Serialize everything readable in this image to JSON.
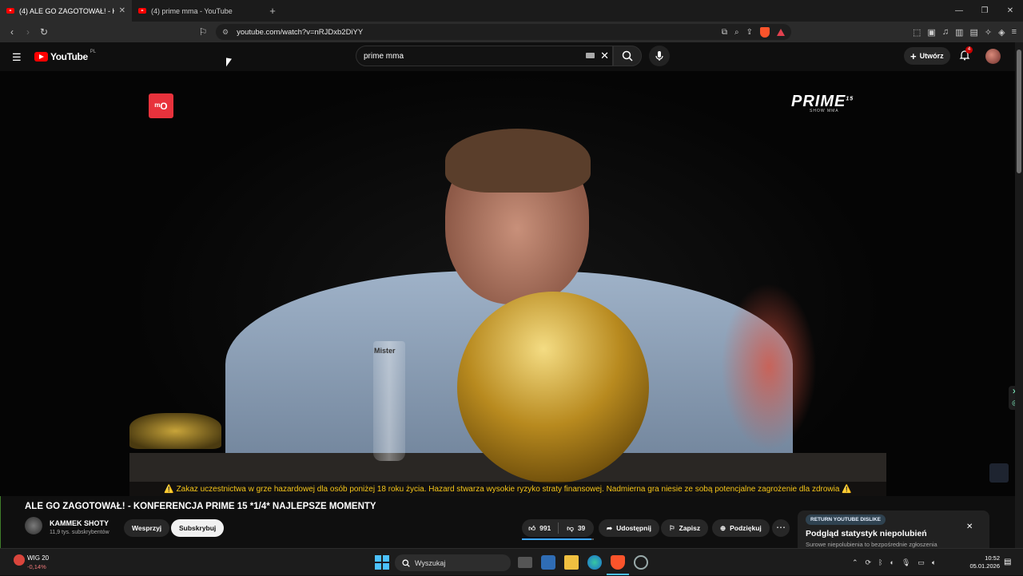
{
  "browser": {
    "tabs": [
      {
        "title": "(4) ALE GO ZAGOTOWAŁ! - K",
        "active": true
      },
      {
        "title": "(4) prime mma - YouTube",
        "active": false
      }
    ],
    "url": "youtube.com/watch?v=nRJDxb2DiYY"
  },
  "youtube": {
    "logo_text": "YouTube",
    "region": "PL",
    "search_query": "prime mma",
    "create_label": "Utwórz",
    "notifications_count": "4"
  },
  "video": {
    "warning_text": "⚠️ Zakaz uczestnictwa w grze hazardowej dla osób poniżej 18 roku życia. Hazard stwarza wysokie ryzyko straty finansowej. Nadmierna gra niesie ze sobą potencjalne zagrożenie dla zdrowia ⚠️",
    "overlay_logo": "PRIME",
    "overlay_logo_sup": "15",
    "overlay_logo_sub": "SHOW MMA",
    "glass_label": "Mister"
  },
  "watch": {
    "title": "ALE GO ZAGOTOWAŁ! - KONFERENCJA PRIME 15 *1/4* NAJLEPSZE MOMENTY",
    "channel_name": "KAMMEK SHOTY",
    "subscribers": "11,9 tys. subskrybentów",
    "support_label": "Wesprzyj",
    "subscribe_label": "Subskrybuj",
    "likes": "991",
    "dislikes": "39",
    "like_ratio": 0.962,
    "share_label": "Udostępnij",
    "save_label": "Zapisz",
    "thanks_label": "Podziękuj"
  },
  "ryd_card": {
    "tag": "RETURN YOUTUBE DISLIKE",
    "heading": "Podgląd statystyk niepolubień",
    "subtext": "Surowe niepolubienia to bezpośrednie zgłoszenia"
  },
  "taskbar": {
    "widget_name": "WIG 20",
    "widget_change": "-0,14%",
    "search_placeholder": "Wyszukaj",
    "time": "10:52",
    "date": "05.01.2026"
  },
  "colors": {
    "accent": "#3ea6ff",
    "yt_red": "#ff0000",
    "warning": "#f5c518"
  }
}
